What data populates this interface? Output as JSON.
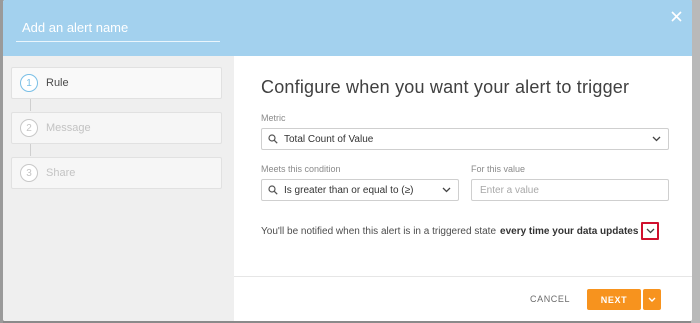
{
  "header": {
    "name_placeholder": "Add an alert name",
    "close_icon": "close-icon"
  },
  "steps": [
    {
      "number": "1",
      "label": "Rule",
      "active": true
    },
    {
      "number": "2",
      "label": "Message",
      "active": false
    },
    {
      "number": "3",
      "label": "Share",
      "active": false
    }
  ],
  "main": {
    "title": "Configure when you want your alert to trigger",
    "metric": {
      "label": "Metric",
      "value": "Total Count of Value"
    },
    "condition": {
      "label": "Meets this condition",
      "value": "Is greater than or equal to (≥)"
    },
    "value_field": {
      "label": "For this value",
      "placeholder": "Enter a value",
      "value": ""
    },
    "notify_text": "You'll be notified when this alert is in a triggered state",
    "notify_frequency": "every time your data updates"
  },
  "footer": {
    "cancel_label": "CANCEL",
    "next_label": "NEXT"
  },
  "colors": {
    "header_bg": "#a3d1ee",
    "accent_orange": "#f7931e",
    "highlight_red": "#d0102d",
    "active_step_blue": "#79bfe6"
  }
}
